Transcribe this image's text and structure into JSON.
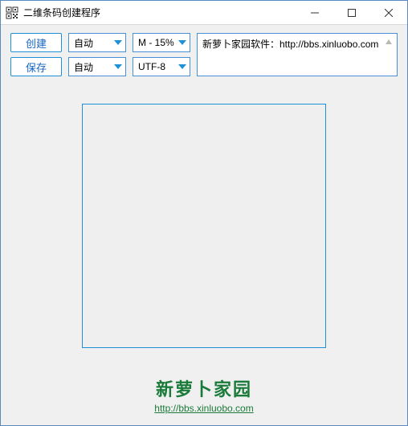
{
  "window": {
    "title": "二维条码创建程序"
  },
  "buttons": {
    "create": "创建",
    "save": "保存"
  },
  "selects": {
    "mode1": "自动",
    "ec": "M - 15%",
    "mode2": "自动",
    "encoding": "UTF-8"
  },
  "textarea": {
    "value": "新萝卜家园软件：http://bbs.xinluobo.com"
  },
  "footer": {
    "brand": "新萝卜家园",
    "link": "http://bbs.xinluobo.com"
  }
}
